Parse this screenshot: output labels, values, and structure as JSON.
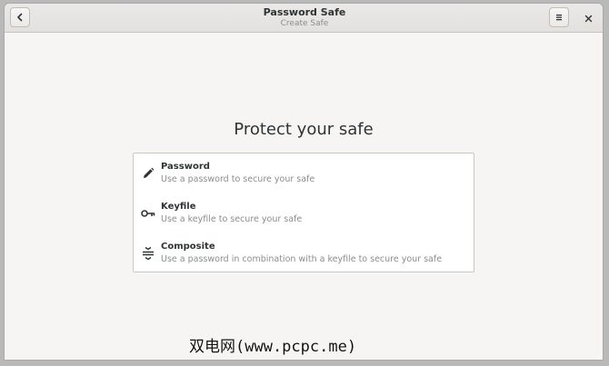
{
  "window": {
    "title": "Password Safe",
    "subtitle": "Create Safe"
  },
  "icons": {
    "back": "back-arrow-icon",
    "menu": "hamburger-menu-icon",
    "close": "close-icon"
  },
  "main": {
    "heading": "Protect your safe",
    "options": [
      {
        "label": "Password",
        "description": "Use a password to secure your safe",
        "icon": "pencil-icon"
      },
      {
        "label": "Keyfile",
        "description": "Use a keyfile to secure your safe",
        "icon": "key-icon"
      },
      {
        "label": "Composite",
        "description": "Use a password in combination with a keyfile to secure your safe",
        "icon": "composite-icon"
      }
    ]
  },
  "watermark": "双电网(www.pcpc.me)",
  "colors": {
    "background": "#f6f5f4",
    "text": "#2e3436",
    "secondary_text": "#8a8d8e"
  }
}
